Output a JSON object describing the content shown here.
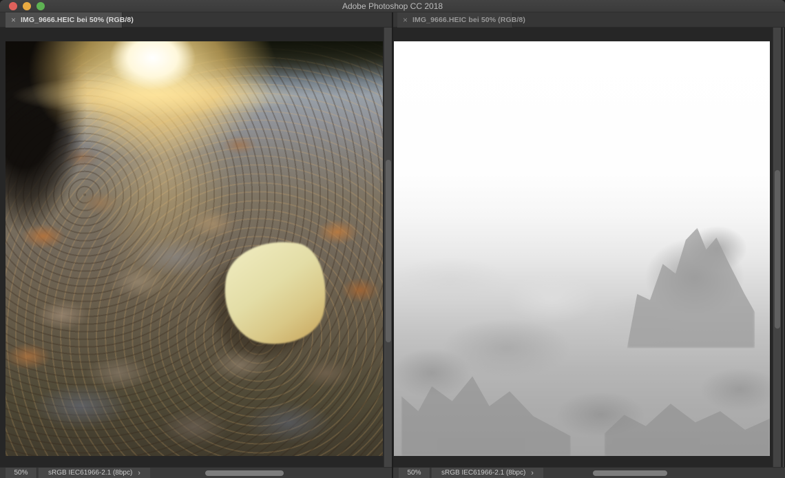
{
  "window": {
    "title": "Adobe Photoshop CC 2018"
  },
  "traffic_lights": {
    "close_color": "#e0615b",
    "minimize_color": "#e9aa41",
    "zoom_color": "#5eb253"
  },
  "panes": {
    "left": {
      "tab": {
        "label": "IMG_9666.HEIC bei 50% (RGB/8)",
        "close_glyph": "×",
        "state": "active"
      },
      "status": {
        "zoom_level": "50%",
        "color_profile": "sRGB IEC61966-2.1 (8bpc)",
        "chevron_glyph": "›"
      },
      "canvas": {
        "content": "Color photo: frosty path covered with dry brown and orange autumn leaves, low sun flaring at top center, one pale yellow leaf standing out right of center"
      }
    },
    "right": {
      "tab": {
        "label": "IMG_9666.HEIC bei 50% (RGB/8)",
        "close_glyph": "×",
        "state": "inactive"
      },
      "status": {
        "zoom_level": "50%",
        "color_profile": "sRGB IEC61966-2.1 (8bpc)",
        "chevron_glyph": "›"
      },
      "canvas": {
        "content": "Grayscale depth map of the same photo: white (far) at the top fading into gray leaf-shaped blobs (near) toward the bottom"
      }
    }
  },
  "colors": {
    "titlebar_bg": "#3d3d3d",
    "tab_bar_bg": "#363636",
    "tab_active_bg": "#4f4f4f",
    "canvas_bg": "#262626",
    "status_bar_bg": "#3a3a3a",
    "status_widget_bg": "#474747",
    "scroll_thumb": "#7d7d7d"
  }
}
